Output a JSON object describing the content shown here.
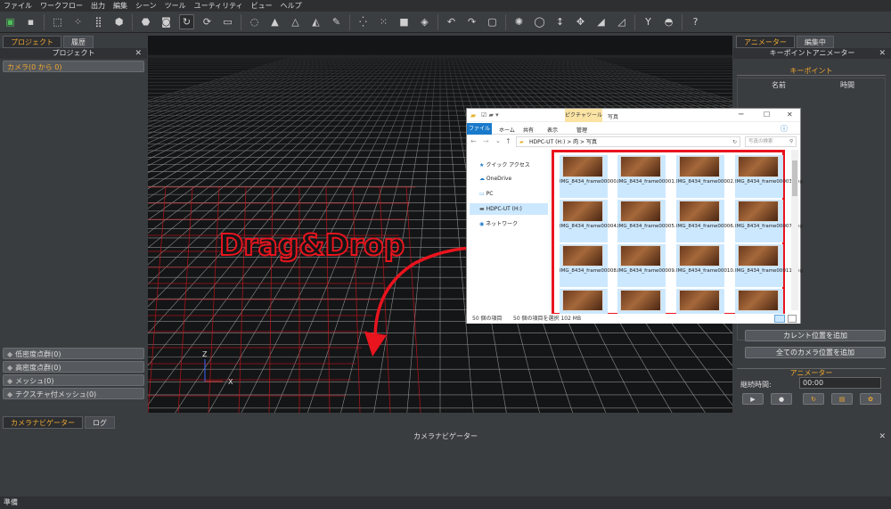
{
  "menu": [
    "ファイル",
    "ワークフロー",
    "出力",
    "編集",
    "シーン",
    "ツール",
    "ユーティリティ",
    "ビュー",
    "ヘルプ"
  ],
  "left_panel": {
    "tabs": [
      "プロジェクト",
      "履歴"
    ],
    "header": "プロジェクト",
    "camera_item": "カメラ(0 から 0)",
    "buttons": [
      "低密度点群(0)",
      "高密度点群(0)",
      "メッシュ(0)",
      "テクスチャ付メッシュ(0)"
    ]
  },
  "viewport": {
    "overlay_text": "Drag&Drop",
    "axis_z": "Z",
    "axis_x": "X"
  },
  "right_panel": {
    "tabs": [
      "アニメーター",
      "編集中"
    ],
    "header": "キーポイントアニメーター",
    "keypoint_section": "キーポイント",
    "columns": [
      "名前",
      "時間"
    ],
    "add_current": "カレント位置を追加",
    "add_all_cameras": "全てのカメラ位置を追加",
    "animator_section": "アニメーター",
    "duration_label": "継続時間:",
    "duration_value": "00:00"
  },
  "bottom_panel": {
    "tabs": [
      "カメラナビゲーター",
      "ログ"
    ],
    "header": "カメラナビゲーター"
  },
  "status": "準備",
  "explorer": {
    "title": "写真",
    "context_tab": "ピクチャツール",
    "ribbon_tabs": [
      "ファイル",
      "ホーム",
      "共有",
      "表示",
      "管理"
    ],
    "path": "HDPC-UT (H:) > 肉 > 写真",
    "search_placeholder": "写真の検索",
    "nav_items": [
      "クイック アクセス",
      "OneDrive",
      "PC",
      "HDPC-UT (H:)",
      "ネットワーク"
    ],
    "files": [
      "IMG_8434_frame00000.png",
      "IMG_8434_frame00001.png",
      "IMG_8434_frame00002.png",
      "IMG_8434_frame00003.png",
      "IMG_8434_frame00004.png",
      "IMG_8434_frame00005.png",
      "IMG_8434_frame00006.png",
      "IMG_8434_frame00007.png",
      "IMG_8434_frame00008.png",
      "IMG_8434_frame00009.png",
      "IMG_8434_frame00010.png",
      "IMG_8434_frame00011.png"
    ],
    "status_count": "50 個の項目",
    "status_selected": "50 個の項目を選択  102 MB"
  },
  "colors": {
    "accent": "#f0a830",
    "highlight": "#e8141e",
    "grid": "#8c8c8c"
  }
}
